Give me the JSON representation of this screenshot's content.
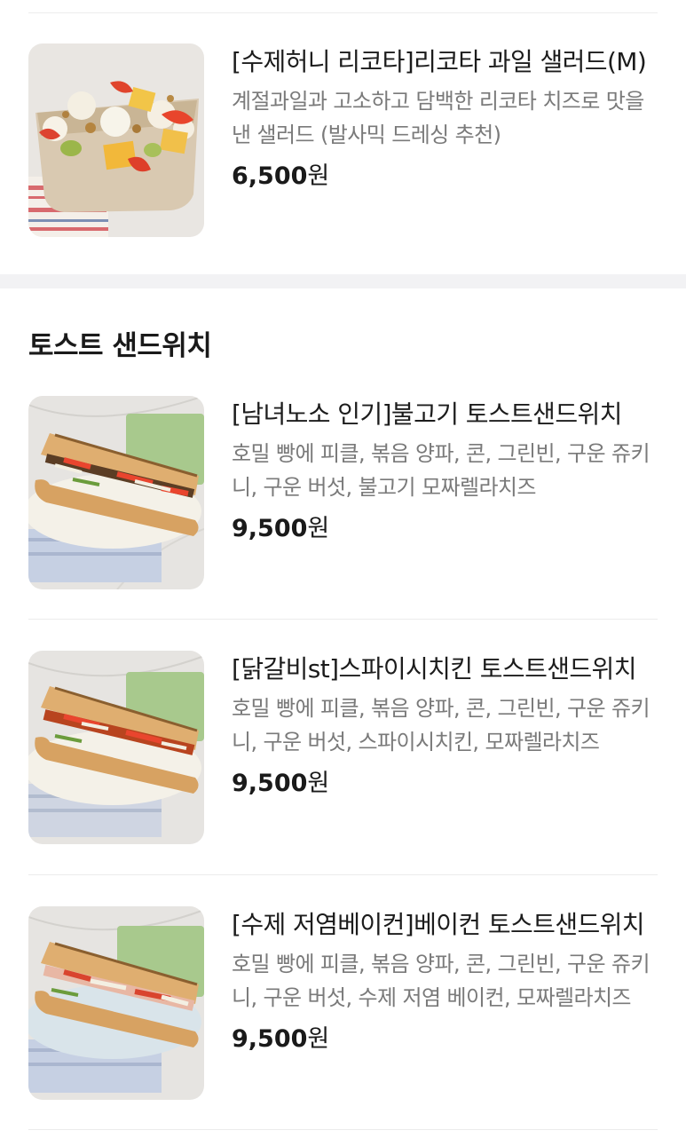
{
  "items_top": [
    {
      "name": "[수제허니 리코타]리코타 과일 샐러드(M)",
      "description": "계절과일과 고소하고 담백한 리코타 치즈로 맛을 낸 샐러드 (발사믹 드레싱 추천)",
      "price": "6,500",
      "currency": "원",
      "image_icon": "salad-image"
    }
  ],
  "section": {
    "title": "토스트 샌드위치"
  },
  "items_section": [
    {
      "name": "[남녀노소 인기]불고기 토스트샌드위치",
      "description": "호밀 빵에 피클, 볶음 양파, 콘, 그린빈, 구운 쥬키니, 구운 버섯, 불고기 모짜렐라치즈",
      "price": "9,500",
      "currency": "원",
      "image_icon": "sandwich-image"
    },
    {
      "name": "[닭갈비st]스파이시치킨 토스트샌드위치",
      "description": "호밀 빵에 피클, 볶음 양파, 콘, 그린빈, 구운 쥬키니, 구운 버섯, 스파이시치킨, 모짜렐라치즈",
      "price": "9,500",
      "currency": "원",
      "image_icon": "sandwich-image"
    },
    {
      "name": "[수제 저염베이컨]베이컨 토스트샌드위치",
      "description": "호밀 빵에 피클, 볶음 양파, 콘, 그린빈, 구운 쥬키니, 구운 버섯, 수제 저염 베이컨, 모짜렐라치즈",
      "price": "9,500",
      "currency": "원",
      "image_icon": "sandwich-image"
    }
  ],
  "colors": {
    "text": "#1a1a1a",
    "muted": "#7a7a7a",
    "divider": "#ececec",
    "section_bg": "#f2f2f4"
  }
}
